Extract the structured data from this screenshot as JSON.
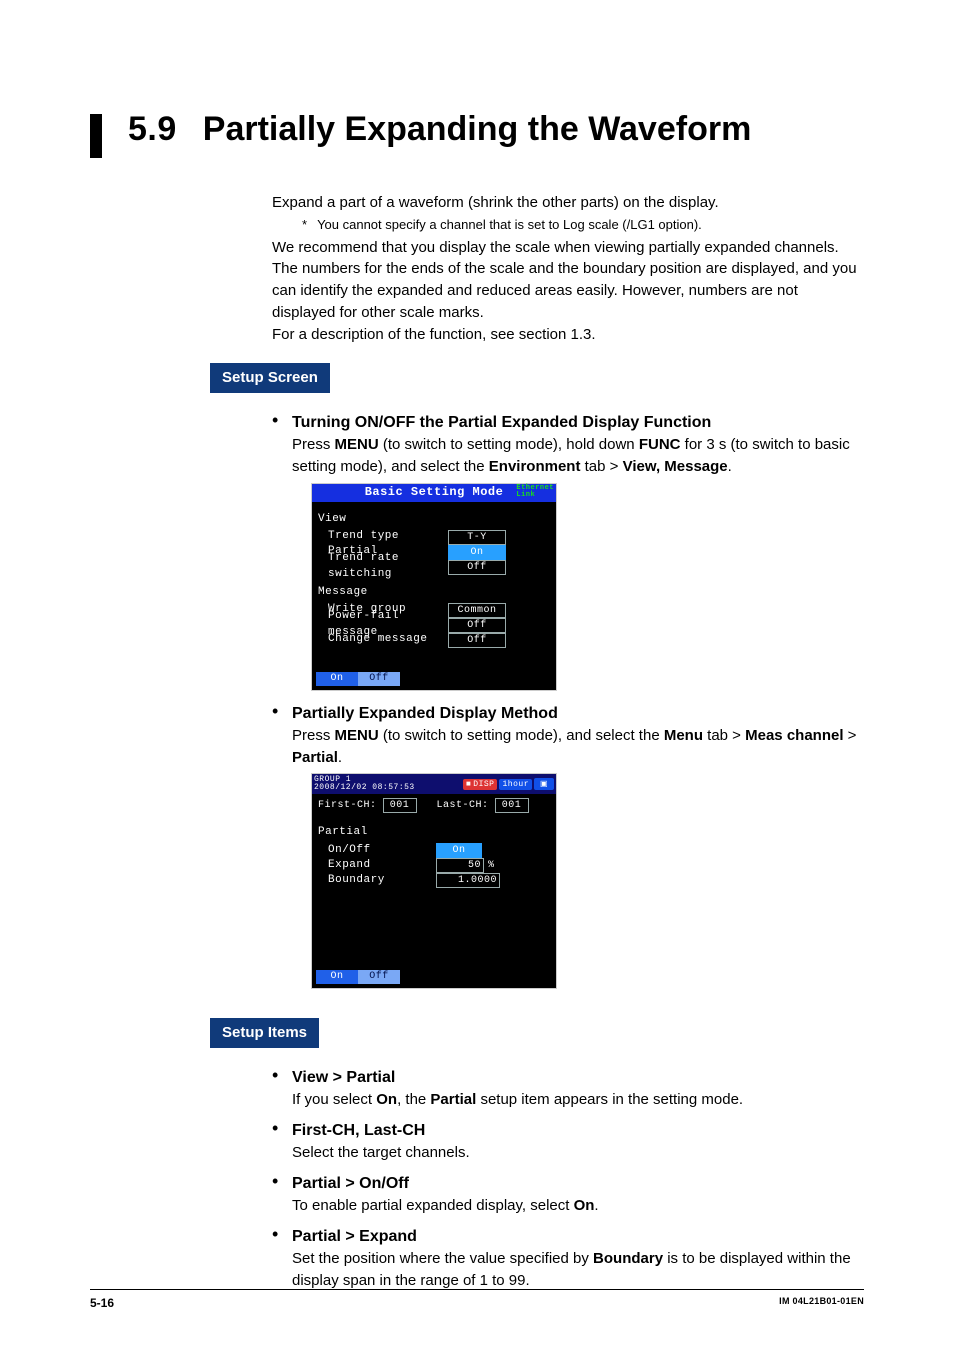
{
  "heading": {
    "num": "5.9",
    "title": "Partially Expanding the Waveform"
  },
  "intro": {
    "p1": "Expand a part of a waveform (shrink the other parts) on the display.",
    "note": "You cannot specify a channel that is set to Log scale (/LG1 option).",
    "p2a": "We recommend that you display the scale when viewing partially expanded channels. The numbers for the ends of the scale and the boundary position are displayed, and you can identify the expanded and reduced areas easily. However, numbers are not displayed for other scale marks.",
    "p3": "For a description of the function, see section 1.3."
  },
  "sections": {
    "setup_screen": "Setup Screen",
    "setup_items": "Setup Items"
  },
  "screen_bullets": {
    "b1_title": "Turning ON/OFF the Partial Expanded Display Function",
    "b1_body_pre": "Press ",
    "b1_menu": "MENU",
    "b1_body_mid1": " (to switch to setting mode), hold down ",
    "b1_func": "FUNC",
    "b1_body_mid2": " for 3 s (to switch to basic setting mode), and select the ",
    "b1_env": "Environment",
    "b1_body_mid3": " tab > ",
    "b1_view": "View, Message",
    "b1_body_end": ".",
    "b2_title": "Partially Expanded Display Method",
    "b2_body_pre": "Press ",
    "b2_menu": "MENU",
    "b2_body_mid1": " (to switch to setting mode), and select the ",
    "b2_menu_tab": "Menu",
    "b2_body_mid2": " tab > ",
    "b2_meas": "Meas channel",
    "b2_body_mid3": " > ",
    "b2_partial": "Partial",
    "b2_body_end": "."
  },
  "dev1": {
    "title": "Basic Setting Mode",
    "eth1": "Ethernet",
    "eth2": "Link",
    "view_hdr": "View",
    "rows": {
      "trend_type": {
        "label": "Trend type",
        "value": "T-Y"
      },
      "partial": {
        "label": "Partial",
        "value": "On"
      },
      "trend_rate": {
        "label": "Trend rate switching",
        "value": "Off"
      }
    },
    "msg_hdr": "Message",
    "mrows": {
      "write_group": {
        "label": "Write group",
        "value": "Common"
      },
      "power_fail": {
        "label": "Power-fail message",
        "value": "Off"
      },
      "change_msg": {
        "label": "Change message",
        "value": "Off"
      }
    },
    "soft": {
      "on": "On",
      "off": "Off"
    }
  },
  "dev2": {
    "group": "GROUP 1",
    "timestamp": "2008/12/02 08:57:53",
    "disp_chip": "DISP",
    "time_chip": "1hour",
    "first_lbl": "First-CH:",
    "first_val": "001",
    "last_lbl": "Last-CH:",
    "last_val": "001",
    "partial_hdr": "Partial",
    "rows": {
      "onoff": {
        "label": "On/Off",
        "value": "On"
      },
      "expand": {
        "label": "Expand",
        "value": "50",
        "unit": "%"
      },
      "boundary": {
        "label": "Boundary",
        "value": "1.0000"
      }
    },
    "soft": {
      "on": "On",
      "off": "Off"
    }
  },
  "items": {
    "i1_title": "View > Partial",
    "i1_pre": "If you select ",
    "i1_on": "On",
    "i1_mid": ", the ",
    "i1_partial": "Partial",
    "i1_post": " setup item appears in the setting mode.",
    "i2_title": "First-CH, Last-CH",
    "i2_body": "Select the target channels.",
    "i3_title": "Partial > On/Off",
    "i3_pre": "To enable partial expanded display, select ",
    "i3_on": "On",
    "i3_post": ".",
    "i4_title": "Partial > Expand",
    "i4_pre": "Set the position where the value specified by ",
    "i4_boundary": "Boundary",
    "i4_post": " is to be displayed within the display span in the range of 1 to 99."
  },
  "footer": {
    "page": "5-16",
    "doc": "IM 04L21B01-01EN"
  }
}
